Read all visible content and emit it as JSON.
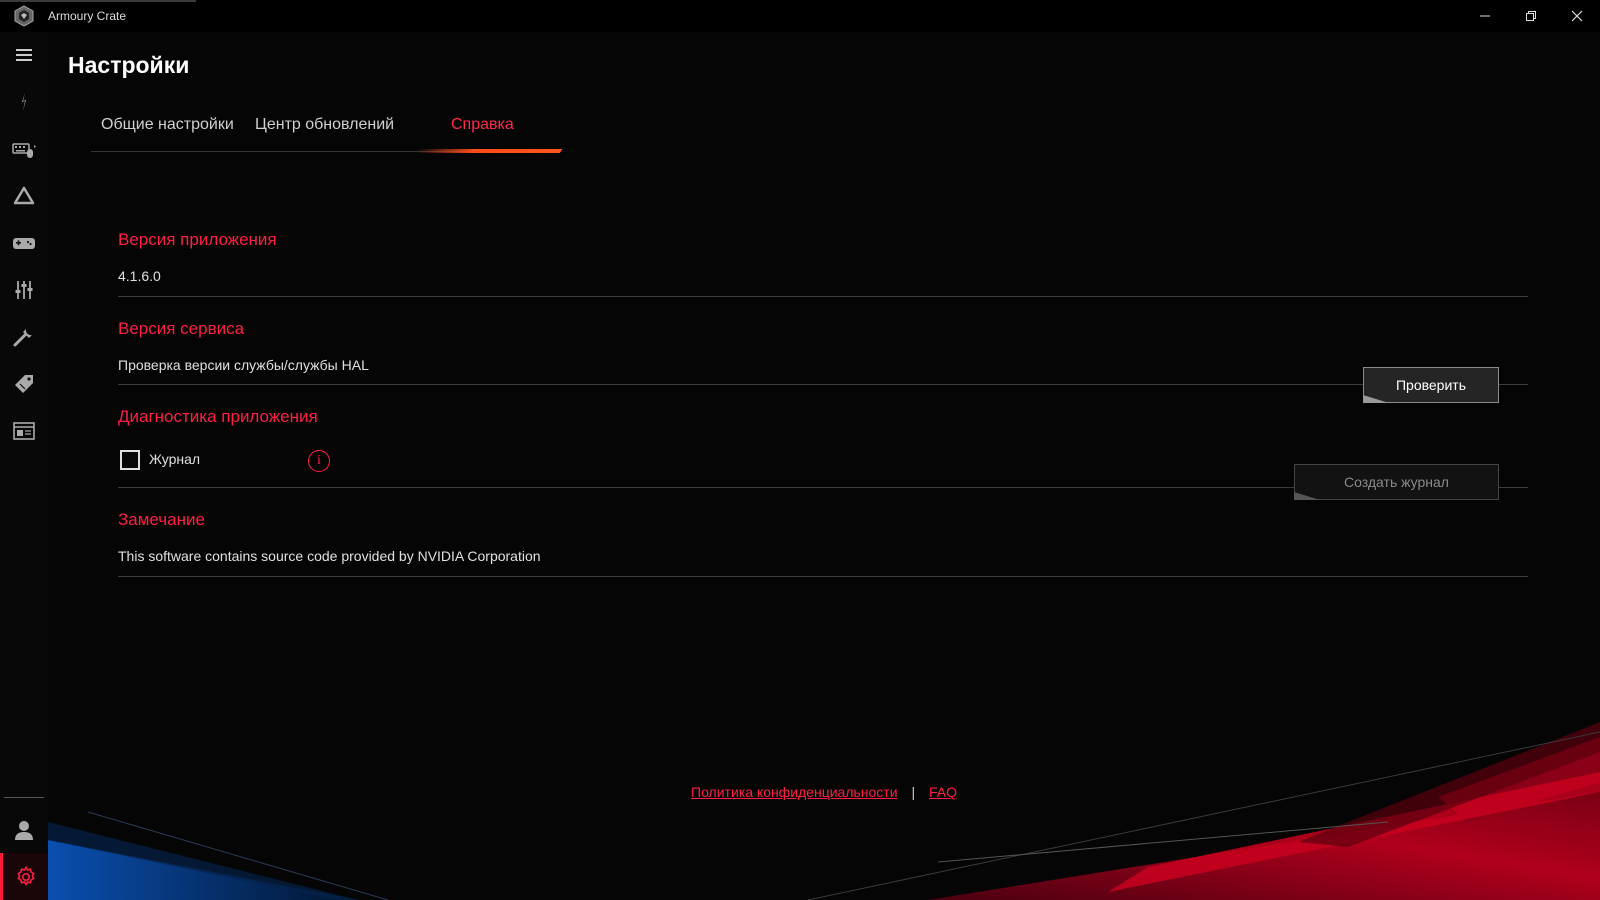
{
  "window": {
    "title": "Armoury Crate",
    "minimize_icon": "minimize-icon",
    "maximize_icon": "restore-icon",
    "close_icon": "close-icon"
  },
  "sidebar": {
    "items": [
      {
        "name": "menu",
        "icon": "hamburger-menu-icon"
      },
      {
        "name": "home",
        "icon": "rog-logo-icon"
      },
      {
        "name": "devices",
        "icon": "keyboard-mouse-icon"
      },
      {
        "name": "aura",
        "icon": "aura-triangle-icon"
      },
      {
        "name": "game-library",
        "icon": "gamepad-icon"
      },
      {
        "name": "scenario-profiles",
        "icon": "sliders-icon"
      },
      {
        "name": "featured-apps",
        "icon": "tools-icon"
      },
      {
        "name": "deals",
        "icon": "price-tag-icon"
      },
      {
        "name": "news",
        "icon": "news-icon"
      }
    ],
    "bottom": [
      {
        "name": "user",
        "icon": "user-icon"
      },
      {
        "name": "settings",
        "icon": "gear-icon",
        "active": true
      }
    ]
  },
  "page": {
    "title": "Настройки"
  },
  "tabs": [
    {
      "label": "Общие настройки",
      "active": false
    },
    {
      "label": "Центр обновлений",
      "active": false
    },
    {
      "label": "Справка",
      "active": true
    }
  ],
  "sections": {
    "app_version": {
      "title": "Версия приложения",
      "value": "4.1.6.0"
    },
    "service_version": {
      "title": "Версия сервиса",
      "text": "Проверка версии службы/службы HAL",
      "button": "Проверить"
    },
    "diagnostics": {
      "title": "Диагностика приложения",
      "checkbox_label": "Журнал",
      "checkbox_checked": false,
      "info_glyph": "i",
      "button": "Создать журнал"
    },
    "notice": {
      "title": "Замечание",
      "text": "This software contains source code provided by NVIDIA Corporation"
    }
  },
  "footer": {
    "privacy_link": "Политика конфиденциальности",
    "separator": "|",
    "faq_link": "FAQ"
  },
  "colors": {
    "accent": "#ff1f45",
    "background": "#050505"
  }
}
